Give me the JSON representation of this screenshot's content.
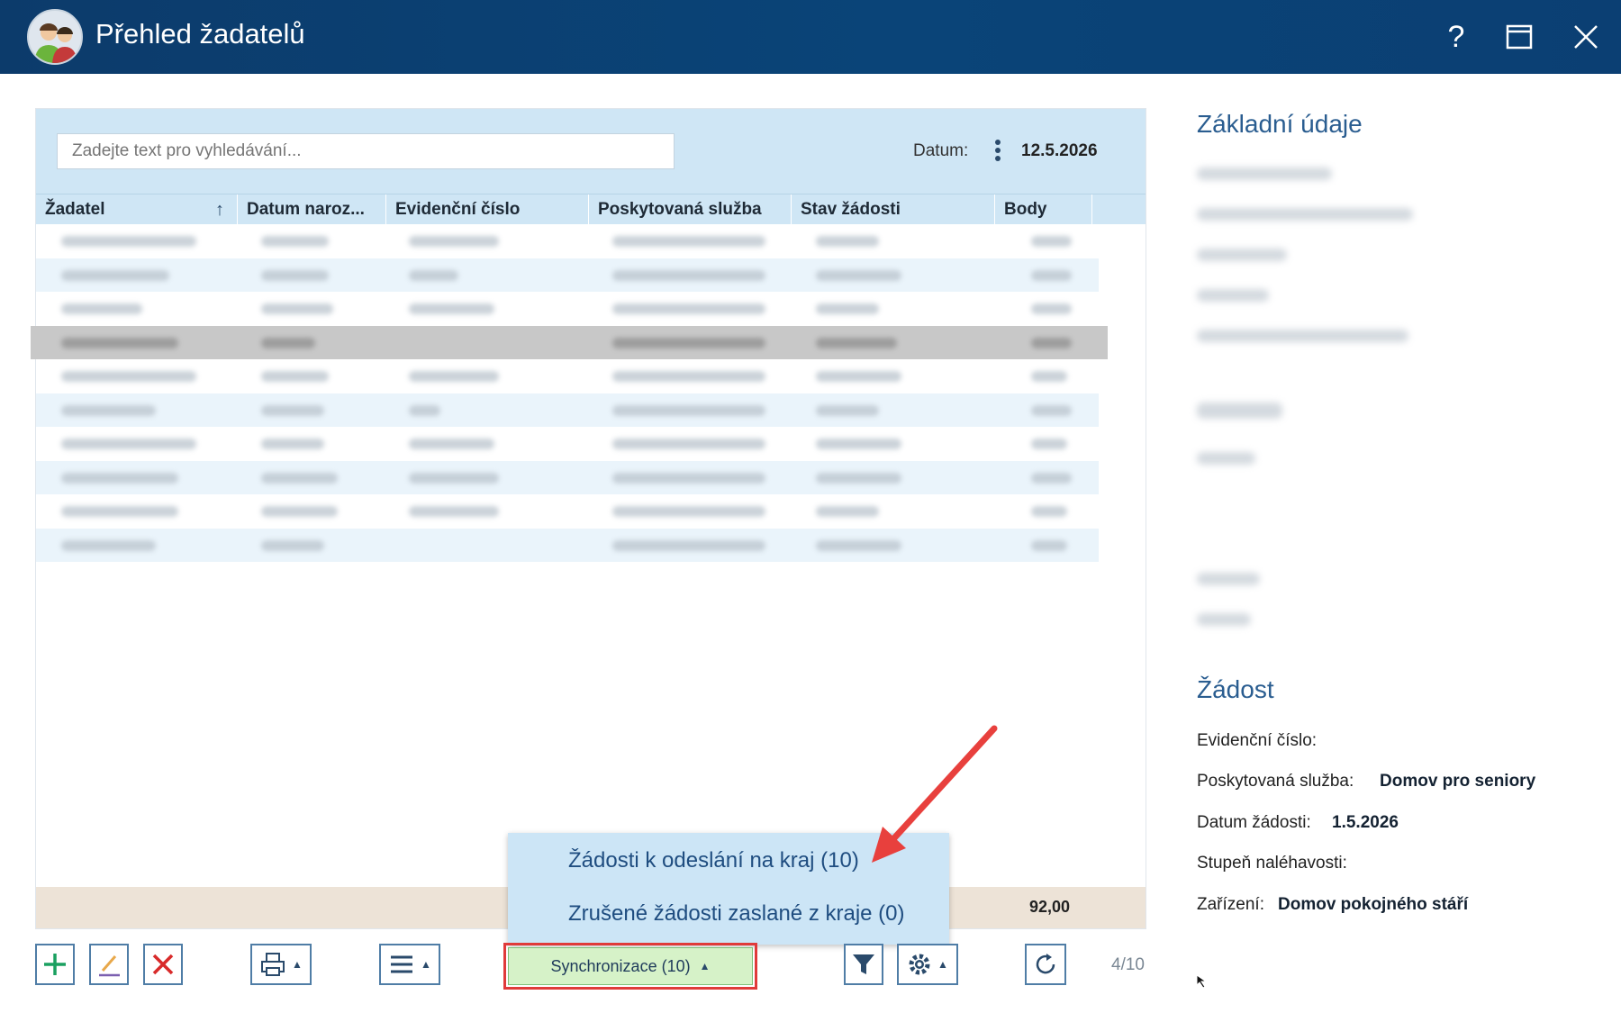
{
  "window": {
    "title": "Přehled žadatelů",
    "help_label": "?"
  },
  "search": {
    "placeholder": "Zadejte text pro vyhledávání..."
  },
  "date_filter": {
    "label": "Datum:",
    "value": "12.5.2026"
  },
  "grid": {
    "columns": [
      "Žadatel",
      "Datum naroz...",
      "Evidenční číslo",
      "Poskytovaná služba",
      "Stav žádosti",
      "Body"
    ],
    "sort_column": "Žadatel",
    "sort_direction": "ascending",
    "row_count": 10,
    "selected_row": 4,
    "total_body": "92,00"
  },
  "dropdown": {
    "items": [
      "Žádosti k odeslání na kraj (10)",
      "Zrušené žádosti zaslané z kraje (0)"
    ]
  },
  "toolbar": {
    "sync_label": "Synchronizace (10)",
    "page_indicator": "4/10"
  },
  "detail": {
    "basic_heading": "Základní údaje",
    "request_heading": "Žádost",
    "evidence_label": "Evidenční číslo:",
    "service_label": "Poskytovaná služba:",
    "service_value": "Domov pro seniory",
    "request_date_label": "Datum žádosti:",
    "request_date_value": "1.5.2026",
    "urgency_label": "Stupeň naléhavosti:",
    "facility_label": "Zařízení:",
    "facility_value": "Domov pokojného stáří"
  },
  "colors": {
    "titlebar": "#0b3f73",
    "grid_header": "#cfe6f5",
    "dropdown_bg": "#cce5f6",
    "sync_button": "#d6f2c8",
    "highlight_box": "#e03a3a",
    "annotation_arrow": "#e8403d"
  }
}
